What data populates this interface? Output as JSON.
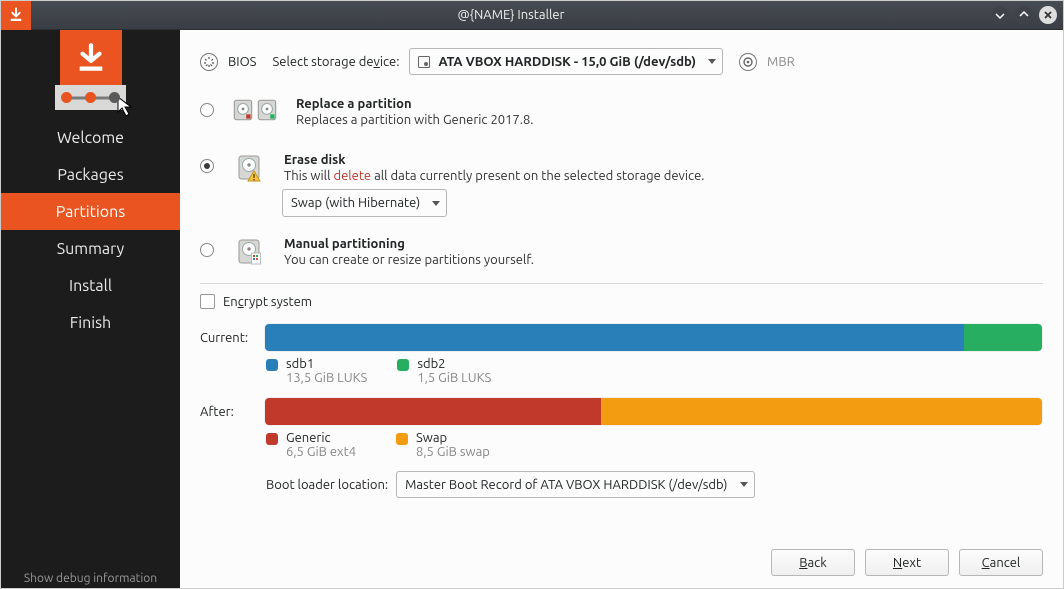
{
  "titlebar": {
    "title": "@{NAME} Installer"
  },
  "sidebar": {
    "items": [
      {
        "label": "Welcome"
      },
      {
        "label": "Packages"
      },
      {
        "label": "Partitions"
      },
      {
        "label": "Summary"
      },
      {
        "label": "Install"
      },
      {
        "label": "Finish"
      }
    ],
    "active_index": 2,
    "debug_text": "Show debug information"
  },
  "top": {
    "bios_label": "BIOS",
    "select_label_pre": "Select storage de",
    "select_label_u": "v",
    "select_label_post": "ice:",
    "storage_value": "ATA VBOX HARDDISK - 15,0 GiB (/dev/sdb)",
    "mbr_label": "MBR"
  },
  "options": {
    "replace": {
      "title": "Replace a partition",
      "desc": "Replaces a partition with Generic 2017.8."
    },
    "erase": {
      "title": "Erase disk",
      "desc_pre": "This will ",
      "desc_red": "delete",
      "desc_post": " all data currently present on the selected storage device.",
      "swap_value": "Swap (with Hibernate)"
    },
    "manual": {
      "title": "Manual partitioning",
      "desc": "You can create or resize partitions yourself."
    }
  },
  "encrypt": {
    "label_pre": "En",
    "label_u": "c",
    "label_post": "rypt system"
  },
  "bars": {
    "current_label": "Current:",
    "after_label": "After:",
    "current": {
      "segments": [
        {
          "color": "blue",
          "pct": 90
        },
        {
          "color": "green",
          "pct": 10
        }
      ],
      "legend": [
        {
          "color": "blue",
          "name": "sdb1",
          "sub": "13,5 GiB  LUKS"
        },
        {
          "color": "green",
          "name": "sdb2",
          "sub": "1,5 GiB  LUKS"
        }
      ]
    },
    "after": {
      "segments": [
        {
          "color": "red",
          "pct": 43.3
        },
        {
          "color": "orange",
          "pct": 56.7
        }
      ],
      "legend": [
        {
          "color": "red",
          "name": "Generic",
          "sub": "6,5 GiB  ext4"
        },
        {
          "color": "orange",
          "name": "Swap",
          "sub": "8,5 GiB  swap"
        }
      ]
    }
  },
  "bootloader": {
    "label": "Boot loader location:",
    "value": "Master Boot Record of ATA VBOX HARDDISK (/dev/sdb)"
  },
  "buttons": {
    "back_u": "B",
    "back_post": "ack",
    "next_u": "N",
    "next_post": "ext",
    "cancel_u": "C",
    "cancel_post": "ancel"
  },
  "chart_data": [
    {
      "type": "bar",
      "title": "Current:",
      "unit": "GiB",
      "total": 15.0,
      "series": [
        {
          "name": "sdb1",
          "value": 13.5,
          "fs": "LUKS",
          "color": "#2980b9"
        },
        {
          "name": "sdb2",
          "value": 1.5,
          "fs": "LUKS",
          "color": "#27ae60"
        }
      ]
    },
    {
      "type": "bar",
      "title": "After:",
      "unit": "GiB",
      "total": 15.0,
      "series": [
        {
          "name": "Generic",
          "value": 6.5,
          "fs": "ext4",
          "color": "#c0392b"
        },
        {
          "name": "Swap",
          "value": 8.5,
          "fs": "swap",
          "color": "#f39c12"
        }
      ]
    }
  ]
}
